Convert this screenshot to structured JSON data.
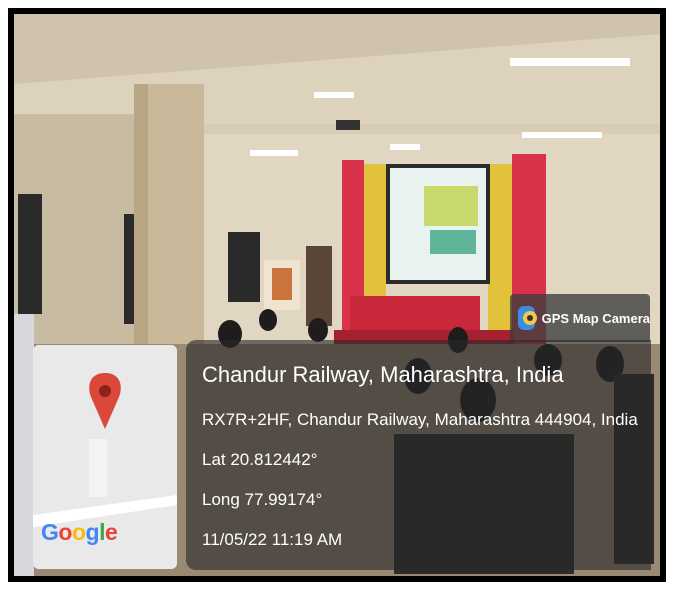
{
  "badge": {
    "label": "GPS Map Camera",
    "icon": "camera-icon"
  },
  "location": {
    "title": "Chandur Railway, Maharashtra, India",
    "address": "RX7R+2HF, Chandur Railway, Maharashtra 444904, India",
    "lat": "Lat 20.812442°",
    "long": "Long 77.99174°",
    "datetime": "11/05/22 11:19 AM"
  },
  "map": {
    "logo": [
      "G",
      "o",
      "o",
      "g",
      "l",
      "e"
    ],
    "logo_colors": [
      "#4285F4",
      "#EA4335",
      "#FBBC05",
      "#4285F4",
      "#34A853",
      "#EA4335"
    ],
    "pin_icon": "map-pin-icon"
  }
}
